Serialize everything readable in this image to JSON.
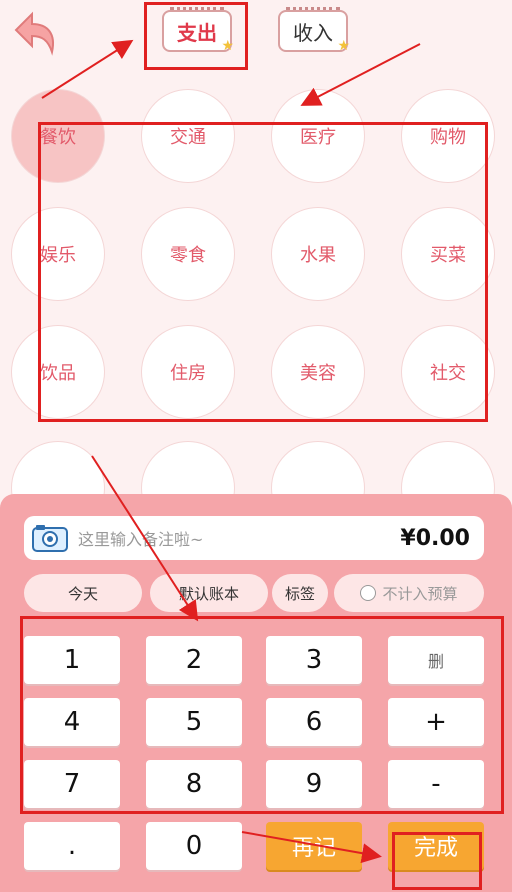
{
  "tabs": {
    "expense": "支出",
    "income": "收入"
  },
  "categories": [
    "餐饮",
    "交通",
    "医疗",
    "购物",
    "娱乐",
    "零食",
    "水果",
    "买菜",
    "饮品",
    "住房",
    "美容",
    "社交"
  ],
  "remark": {
    "placeholder": "这里输入备注啦~",
    "amount": "¥0.00"
  },
  "options": {
    "today": "今天",
    "account": "默认账本",
    "tag": "标签",
    "budget": "不计入预算"
  },
  "keys": {
    "k1": "1",
    "k2": "2",
    "k3": "3",
    "del": "删",
    "k4": "4",
    "k5": "5",
    "k6": "6",
    "plus": "+",
    "k7": "7",
    "k8": "8",
    "k9": "9",
    "minus": "-",
    "dot": ".",
    "k0": "0",
    "again": "再记",
    "done": "完成"
  },
  "colors": {
    "accent": "#e0394a",
    "panel": "#f5a5a9",
    "orange": "#f7a631",
    "annotation": "#e02020"
  }
}
